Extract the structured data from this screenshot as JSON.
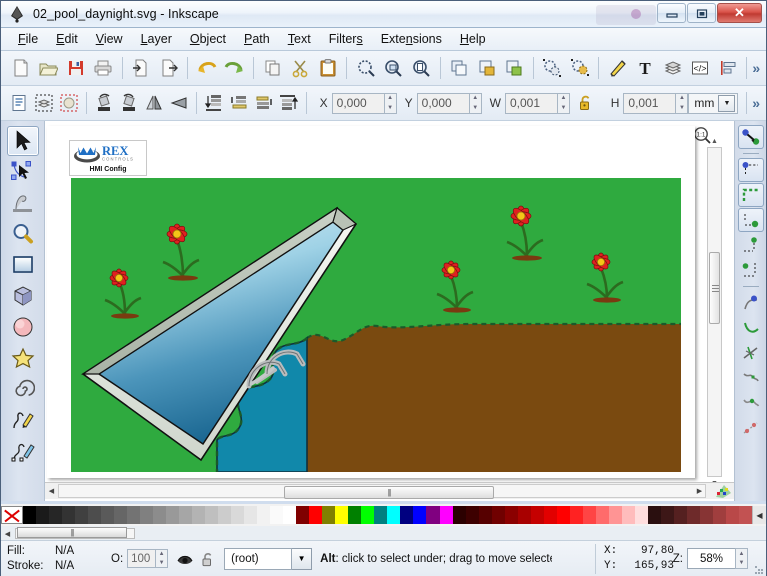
{
  "window": {
    "title": "02_pool_daynight.svg - Inkscape",
    "app_icon": "inkscape-icon",
    "buttons": {
      "minimize": "minimize-button",
      "restore": "restore-button",
      "close": "close-button"
    }
  },
  "menu": {
    "items": [
      {
        "label": "File",
        "mnemonic": "F"
      },
      {
        "label": "Edit",
        "mnemonic": "E"
      },
      {
        "label": "View",
        "mnemonic": "V"
      },
      {
        "label": "Layer",
        "mnemonic": "L"
      },
      {
        "label": "Object",
        "mnemonic": "O"
      },
      {
        "label": "Path",
        "mnemonic": "P"
      },
      {
        "label": "Text",
        "mnemonic": "T"
      },
      {
        "label": "Filters",
        "mnemonic": "s"
      },
      {
        "label": "Extensions",
        "mnemonic": "n"
      },
      {
        "label": "Help",
        "mnemonic": "H"
      }
    ]
  },
  "command_bar": {
    "icons": [
      "new-document-icon",
      "open-document-icon",
      "save-document-icon",
      "print-icon",
      "import-icon",
      "export-icon",
      "undo-icon",
      "redo-icon",
      "copy-icon",
      "cut-icon",
      "paste-icon",
      "zoom-selection-icon",
      "zoom-drawing-icon",
      "zoom-page-icon",
      "duplicate-icon",
      "group-icon",
      "ungroup-icon",
      "fill-stroke-dialog-icon",
      "object-properties-icon",
      "xml-editor-icon",
      "align-distribute-icon",
      "layers-dialog-icon",
      "text-tool-icon",
      "edit-gradient-icon"
    ],
    "overflow_label": "»"
  },
  "tool_options": {
    "icons": [
      "select-all-icon",
      "select-all-layers-icon",
      "deselect-icon",
      "rotate-90-ccw-icon",
      "rotate-90-cw-icon",
      "flip-horizontal-icon",
      "flip-vertical-icon",
      "lower-to-bottom-icon",
      "lower-icon",
      "raise-icon",
      "raise-to-top-icon"
    ],
    "x": {
      "label": "X",
      "value": "0,000"
    },
    "y": {
      "label": "Y",
      "value": "0,000"
    },
    "w": {
      "label": "W",
      "value": "0,001"
    },
    "h": {
      "label": "H",
      "value": "0,001"
    },
    "lock_icon": "lock-open-icon",
    "unit": "mm",
    "overflow_label": "»"
  },
  "toolbox": {
    "tools": [
      {
        "name": "selector-tool",
        "active": true
      },
      {
        "name": "node-editor-tool",
        "active": false
      },
      {
        "name": "tweak-tool",
        "active": false
      },
      {
        "name": "zoom-tool",
        "active": false
      },
      {
        "name": "rectangle-tool",
        "active": false
      },
      {
        "name": "box3d-tool",
        "active": false
      },
      {
        "name": "ellipse-tool",
        "active": false
      },
      {
        "name": "star-tool",
        "active": false
      },
      {
        "name": "spiral-tool",
        "active": false
      },
      {
        "name": "pencil-tool",
        "active": false
      },
      {
        "name": "bezier-tool",
        "active": false
      }
    ]
  },
  "snap_bar": {
    "items": [
      {
        "name": "enable-snapping-toggle",
        "on": true
      },
      {
        "name": "snap-bounding-box-toggle",
        "on": true
      },
      {
        "name": "snap-bbox-edges-toggle",
        "on": true
      },
      {
        "name": "snap-bbox-corners-toggle",
        "on": true
      },
      {
        "name": "snap-bbox-edge-midpoints-toggle",
        "on": false
      },
      {
        "name": "snap-bbox-centers-toggle",
        "on": false
      },
      {
        "name": "snap-nodes-paths-toggle",
        "on": false
      },
      {
        "name": "snap-to-paths-toggle",
        "on": false
      },
      {
        "name": "snap-path-intersections-toggle",
        "on": false
      },
      {
        "name": "snap-to-cusp-nodes-toggle",
        "on": false
      },
      {
        "name": "snap-smooth-nodes-toggle",
        "on": false
      },
      {
        "name": "snap-midpoints-toggle",
        "on": false
      }
    ]
  },
  "canvas": {
    "zoom_1to1_icon": "zoom-1-to-1-icon",
    "logo": {
      "brand": "REX",
      "sub": "CONTROLS",
      "caption": "HMI Config",
      "brand_color": "#1f6fc4"
    },
    "artwork": {
      "title": "swimming-pool-daynight-scene",
      "grass_color": "#2faa3f",
      "dirt_color": "#7a4a10",
      "pond_color": "#1188aa",
      "pond_outline": "#1a5a2a",
      "pool_coping_color": "#e8ece6",
      "water_top_color": "#bfe0ef",
      "water_bottom_color": "#1a6e96",
      "ladder_color": "#b9bcbd",
      "flower_petal_color": "#e02020",
      "flower_center_color": "#f5c518",
      "flower_stem_color": "#2c6b1f",
      "flower_count": 5
    },
    "vscroll": {
      "up": "scroll-up-arrow",
      "down": "scroll-down-arrow"
    },
    "hscroll": {
      "left": "scroll-left-arrow",
      "right": "scroll-right-arrow"
    },
    "palette_toggle_icon": "palette-icon"
  },
  "palette": {
    "none_swatch": "no-color-swatch",
    "colors": [
      "#000000",
      "#1a1a1a",
      "#262626",
      "#333333",
      "#404040",
      "#4d4d4d",
      "#5a5a5a",
      "#666666",
      "#737373",
      "#808080",
      "#8c8c8c",
      "#999999",
      "#a6a6a6",
      "#b3b3b3",
      "#bfbfbf",
      "#cccccc",
      "#d9d9d9",
      "#e6e6e6",
      "#f2f2f2",
      "#fafafa",
      "#ffffff",
      "#800000",
      "#ff0000",
      "#808000",
      "#ffff00",
      "#008000",
      "#00ff00",
      "#008080",
      "#00ffff",
      "#000080",
      "#0000ff",
      "#800080",
      "#ff00ff",
      "#2b0000",
      "#3d0000",
      "#560000",
      "#700000",
      "#8b0000",
      "#a80000",
      "#c50000",
      "#e20000",
      "#ff0000",
      "#ff2222",
      "#ff4444",
      "#ff6b6b",
      "#ff9494",
      "#ffbcbc",
      "#ffdede",
      "#2a0f0f",
      "#3d1717",
      "#552020",
      "#6e2a2a",
      "#873434",
      "#a03e3e",
      "#b94848",
      "#c25252"
    ],
    "scroll_arrow": "palette-scroll-arrow"
  },
  "status": {
    "fill_label": "Fill:",
    "fill_value": "N/A",
    "stroke_label": "Stroke:",
    "stroke_value": "N/A",
    "opacity_label": "O:",
    "opacity_value": "100",
    "visibility_icon": "layer-visible-icon",
    "lock_icon": "layer-unlocked-icon",
    "layer_value": "(root)",
    "hint_prefix": "Alt",
    "hint_text": ": click to select under; drag to move selected or sele",
    "x_label": "X:",
    "x_value": "97,80",
    "y_label": "Y:",
    "y_value": "165,93",
    "zoom_label": "Z:",
    "zoom_value": "58%",
    "resize_grip": "resize-grip"
  }
}
